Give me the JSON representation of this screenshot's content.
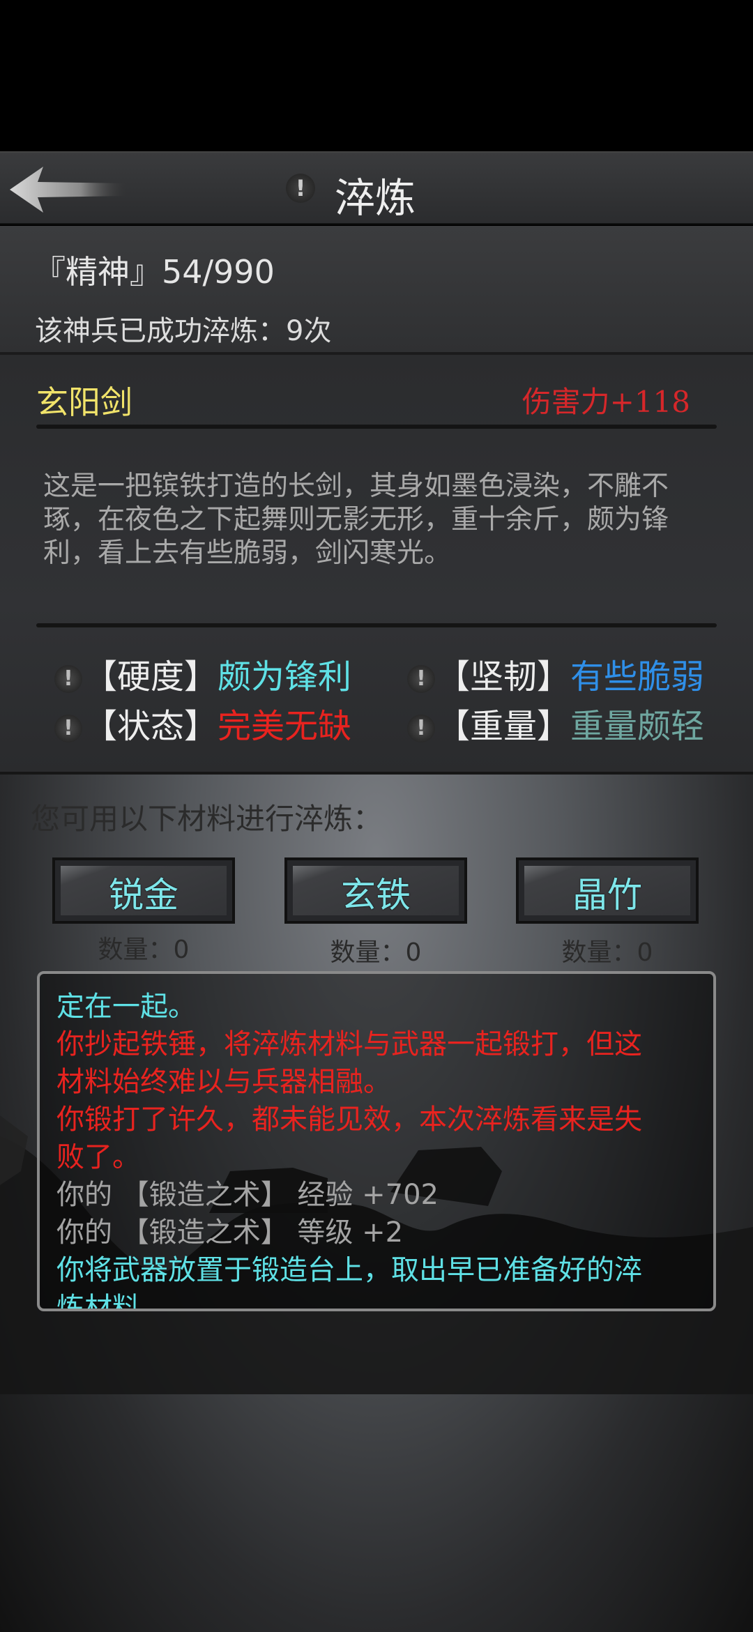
{
  "header": {
    "title": "淬炼",
    "info_glyph": "!"
  },
  "stats": {
    "spirit": "『精神』54/990",
    "refined_count": "该神兵已成功淬炼：9次"
  },
  "weapon": {
    "name": "玄阳剑",
    "damage": "伤害力+118",
    "description": "这是一把镔铁打造的长剑，其身如墨色浸染，不雕不琢，在夜色之下起舞则无影无形，重十余斤，颇为锋利，看上去有些脆弱，剑闪寒光。",
    "attributes": [
      {
        "key": "【硬度】",
        "value": "颇为锋利",
        "color": "#5fe1e6"
      },
      {
        "key": "【坚韧】",
        "value": "有些脆弱",
        "color": "#2f8fe8"
      },
      {
        "key": "【状态】",
        "value": "完美无缺",
        "color": "#e8231f"
      },
      {
        "key": "【重量】",
        "value": "重量颇轻",
        "color": "#6fa7a0"
      }
    ]
  },
  "materials": {
    "label": "您可用以下材料进行淬炼：",
    "items": [
      {
        "name": "锐金",
        "qty": "数量：0"
      },
      {
        "name": "玄铁",
        "qty": "数量：0"
      },
      {
        "name": "晶竹",
        "qty": "数量：0"
      }
    ]
  },
  "log": {
    "lines": [
      {
        "text": "定在一起。",
        "color": "cyan"
      },
      {
        "text": "你抄起铁锤，将淬炼材料与武器一起锻打，但这",
        "color": "red"
      },
      {
        "text": "材料始终难以与兵器相融。",
        "color": "red"
      },
      {
        "text": "你锻打了许久，都未能见效，本次淬炼看来是失",
        "color": "red"
      },
      {
        "text": "败了。",
        "color": "red"
      },
      {
        "text": "你的 【锻造之术】 经验 +702",
        "color": "grey"
      },
      {
        "text": "你的 【锻造之术】 等级 +2",
        "color": "grey"
      },
      {
        "text": "你将武器放置于锻造台上，取出早已准备好的淬",
        "color": "cyan"
      },
      {
        "text": "炼材料",
        "color": "cyan"
      }
    ]
  },
  "colors": {
    "accent_cyan": "#5fe1e6",
    "accent_red": "#e8231f",
    "name_yellow": "#f1e36a"
  }
}
